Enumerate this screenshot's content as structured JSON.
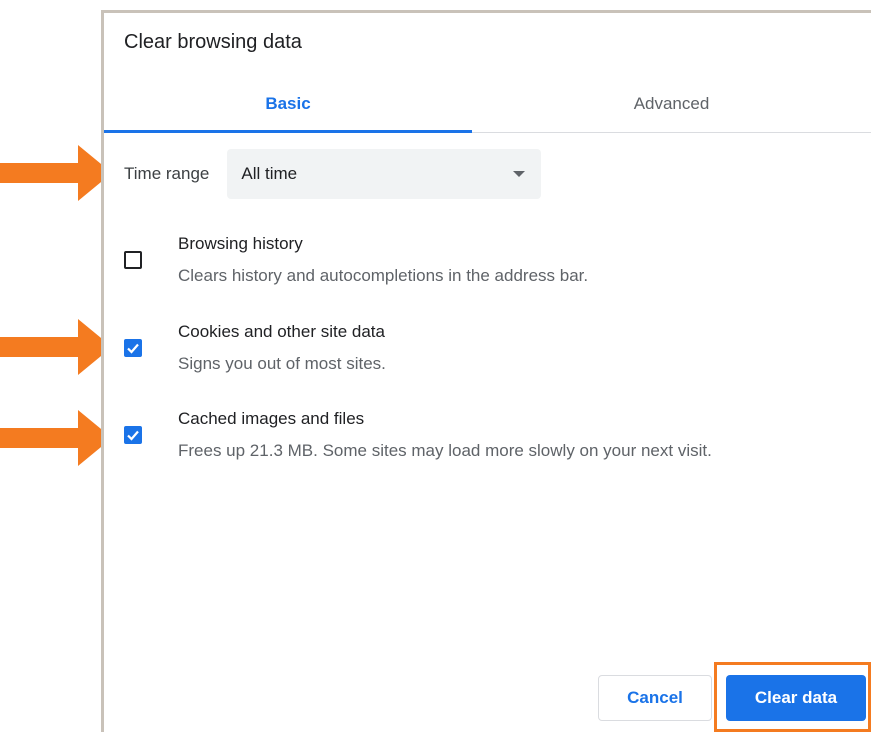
{
  "dialog": {
    "title": "Clear browsing data"
  },
  "tabs": [
    {
      "label": "Basic",
      "selected": true
    },
    {
      "label": "Advanced",
      "selected": false
    }
  ],
  "time_range": {
    "label": "Time range",
    "value": "All time"
  },
  "options": [
    {
      "title": "Browsing history",
      "description": "Clears history and autocompletions in the address bar.",
      "checked": false
    },
    {
      "title": "Cookies and other site data",
      "description": "Signs you out of most sites.",
      "checked": true
    },
    {
      "title": "Cached images and files",
      "description": "Frees up 21.3 MB. Some sites may load more slowly on your next visit.",
      "checked": true
    }
  ],
  "buttons": {
    "cancel": "Cancel",
    "clear": "Clear data"
  },
  "colors": {
    "accent": "#1a73e8",
    "annotation": "#f47b20"
  }
}
